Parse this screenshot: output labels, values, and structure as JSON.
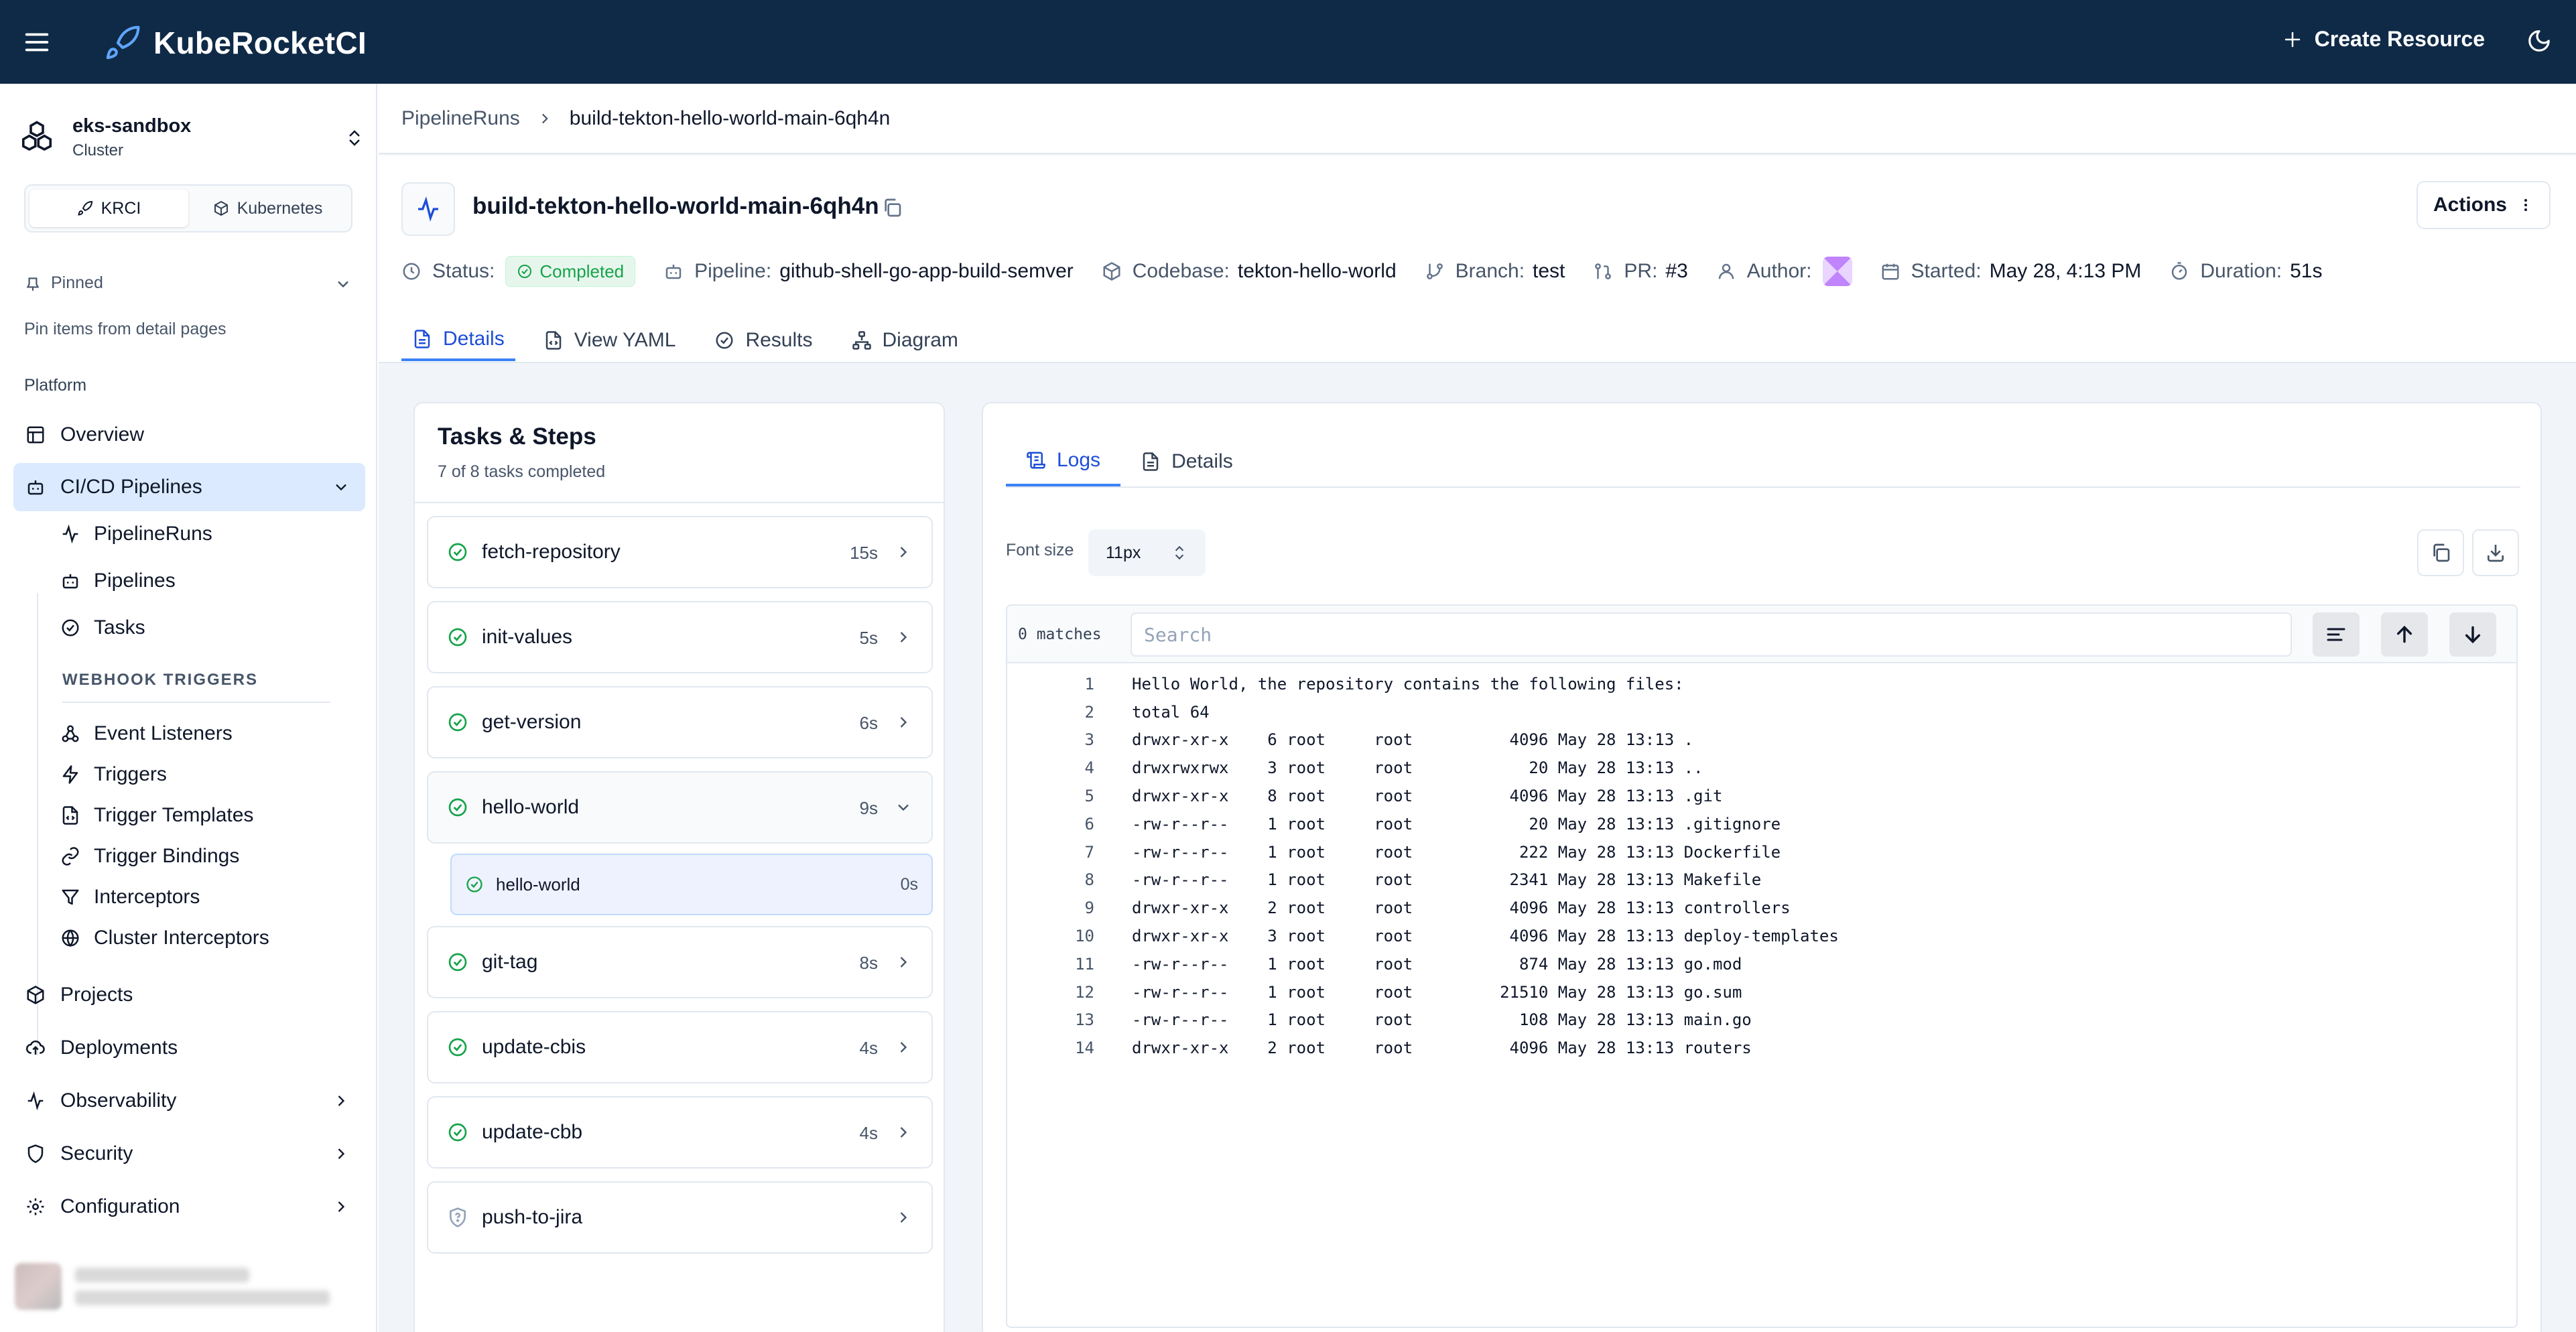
{
  "app": {
    "title": "KubeRocketCI",
    "create_label": "Create Resource"
  },
  "sidebar": {
    "cluster_name": "eks-sandbox",
    "cluster_sub": "Cluster",
    "switcher": [
      "KRCI",
      "Kubernetes"
    ],
    "pinned_label": "Pinned",
    "pin_hint": "Pin items from detail pages",
    "section_label": "Platform",
    "items": [
      {
        "label": "Overview"
      },
      {
        "label": "CI/CD Pipelines"
      },
      {
        "label": "Projects"
      },
      {
        "label": "Deployments"
      },
      {
        "label": "Observability"
      },
      {
        "label": "Security"
      },
      {
        "label": "Configuration"
      }
    ],
    "cicd_sub": [
      "PipelineRuns",
      "Pipelines",
      "Tasks"
    ],
    "webhook_label": "WEBHOOK TRIGGERS",
    "webhook_sub": [
      "Event Listeners",
      "Triggers",
      "Trigger Templates",
      "Trigger Bindings",
      "Interceptors",
      "Cluster Interceptors"
    ]
  },
  "breadcrumb": {
    "parent": "PipelineRuns",
    "current": "build-tekton-hello-world-main-6qh4n"
  },
  "header": {
    "title": "build-tekton-hello-world-main-6qh4n",
    "actions_label": "Actions",
    "status_label": "Status:",
    "status_value": "Completed",
    "pipeline_label": "Pipeline:",
    "pipeline_value": "github-shell-go-app-build-semver",
    "codebase_label": "Codebase:",
    "codebase_value": "tekton-hello-world",
    "branch_label": "Branch:",
    "branch_value": "test",
    "pr_label": "PR:",
    "pr_value": "#3",
    "author_label": "Author:",
    "started_label": "Started:",
    "started_value": "May 28, 4:13 PM",
    "duration_label": "Duration:",
    "duration_value": "51s",
    "tabs": [
      "Details",
      "View YAML",
      "Results",
      "Diagram"
    ],
    "colors": {
      "accent": "#3b82f6",
      "success": "#16a34a",
      "topbar": "#0f2a47"
    }
  },
  "tasks": {
    "title": "Tasks & Steps",
    "subtitle": "7 of 8 tasks completed",
    "items": [
      {
        "name": "fetch-repository",
        "duration": "15s"
      },
      {
        "name": "init-values",
        "duration": "5s"
      },
      {
        "name": "get-version",
        "duration": "6s"
      },
      {
        "name": "hello-world",
        "duration": "9s"
      },
      {
        "name": "git-tag",
        "duration": "8s"
      },
      {
        "name": "update-cbis",
        "duration": "4s"
      },
      {
        "name": "update-cbb",
        "duration": "4s"
      },
      {
        "name": "push-to-jira",
        "duration": ""
      }
    ],
    "step": {
      "name": "hello-world",
      "duration": "0s"
    }
  },
  "logs": {
    "tabs": [
      "Logs",
      "Details"
    ],
    "font_label": "Font size",
    "font_value": "11px",
    "matches": "0 matches",
    "search_placeholder": "Search",
    "lines": [
      "Hello World, the repository contains the following files:",
      "total 64",
      "drwxr-xr-x    6 root     root          4096 May 28 13:13 .",
      "drwxrwxrwx    3 root     root            20 May 28 13:13 ..",
      "drwxr-xr-x    8 root     root          4096 May 28 13:13 .git",
      "-rw-r--r--    1 root     root            20 May 28 13:13 .gitignore",
      "-rw-r--r--    1 root     root           222 May 28 13:13 Dockerfile",
      "-rw-r--r--    1 root     root          2341 May 28 13:13 Makefile",
      "drwxr-xr-x    2 root     root          4096 May 28 13:13 controllers",
      "drwxr-xr-x    3 root     root          4096 May 28 13:13 deploy-templates",
      "-rw-r--r--    1 root     root           874 May 28 13:13 go.mod",
      "-rw-r--r--    1 root     root         21510 May 28 13:13 go.sum",
      "-rw-r--r--    1 root     root           108 May 28 13:13 main.go",
      "drwxr-xr-x    2 root     root          4096 May 28 13:13 routers"
    ]
  }
}
